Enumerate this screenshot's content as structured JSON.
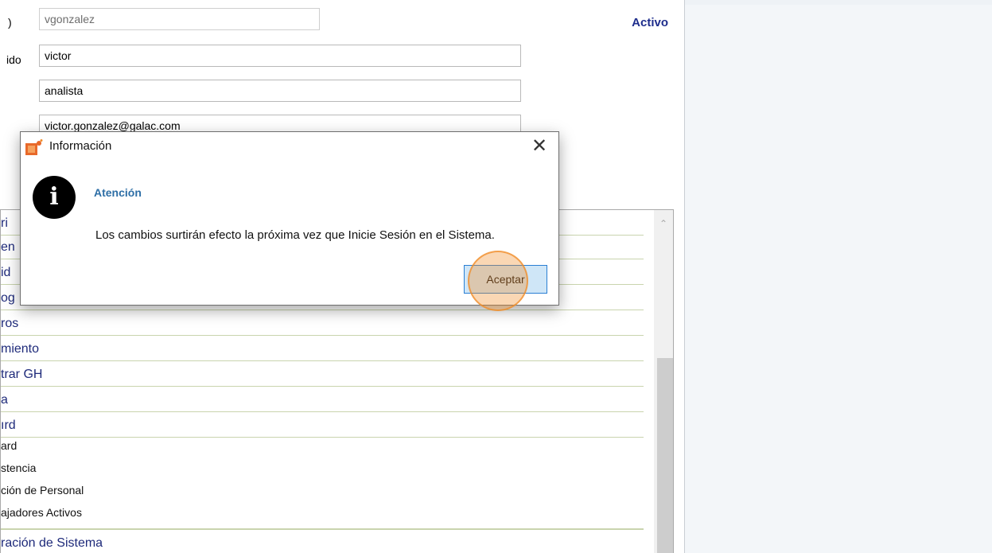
{
  "form": {
    "label_top": ")",
    "label_nombre": "ido",
    "username": "vgonzalez",
    "first_name": "victor",
    "role": "analista",
    "email": "victor.gonzalez@galac.com",
    "status": "Activo"
  },
  "list": {
    "items": [
      {
        "label": "ri"
      },
      {
        "label": "en"
      },
      {
        "label": "id"
      },
      {
        "label": "og"
      },
      {
        "label": "ros"
      },
      {
        "label": "miento"
      },
      {
        "label": "trar GH"
      },
      {
        "label": "a"
      },
      {
        "label": "ırd"
      }
    ],
    "sub_items": [
      {
        "label": "ard"
      },
      {
        "label": "stencia"
      },
      {
        "label": "ción de Personal"
      },
      {
        "label": "ajadores Activos"
      }
    ],
    "last_item": "ración de Sistema"
  },
  "dialog": {
    "title": "Información",
    "heading": "Atención",
    "message": "Los cambios surtirán efecto la próxima vez que Inicie Sesión en el Sistema.",
    "ok_label": "Aceptar",
    "close_glyph": "✕",
    "info_glyph": "i"
  },
  "colors": {
    "accent_blue": "#1e2d8c",
    "heading_blue": "#2d6ea6",
    "button_bg": "#cfe6f7",
    "button_border": "#2a7fd3",
    "click_highlight": "#f08c28"
  }
}
